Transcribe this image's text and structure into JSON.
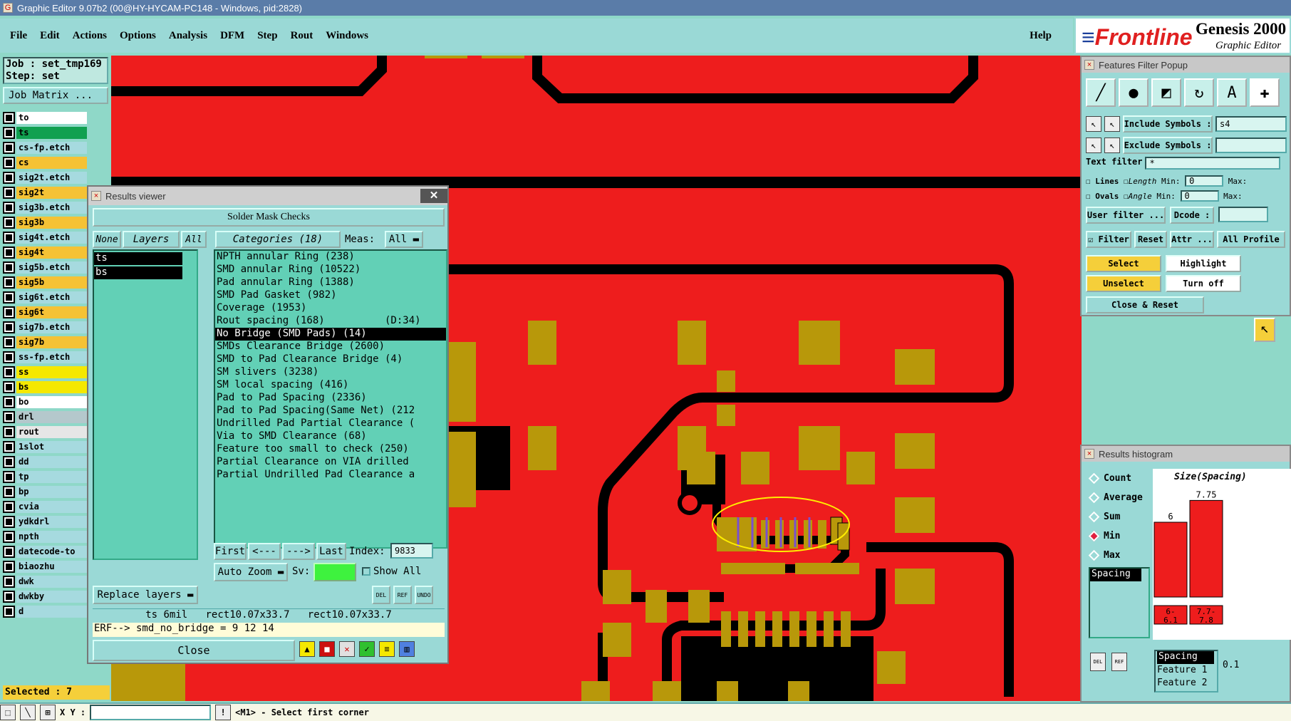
{
  "window": {
    "title": "Graphic Editor 9.07b2 (00@HY-HYCAM-PC148 - Windows, pid:2828)"
  },
  "menu": {
    "items": [
      "File",
      "Edit",
      "Actions",
      "Options",
      "Analysis",
      "DFM",
      "Step",
      "Rout",
      "Windows"
    ],
    "help": "Help"
  },
  "brand": {
    "logo": "Frontline",
    "product": "Genesis 2000",
    "subtitle": "Graphic Editor"
  },
  "job": {
    "line1": "Job : set_tmp169",
    "line2": "Step: set",
    "matrix_button": "Job Matrix ..."
  },
  "layers": [
    {
      "name": "to",
      "color": "#ffffff"
    },
    {
      "name": "ts",
      "color": "#10a050"
    },
    {
      "name": "cs-fp.etch",
      "color": "#a6dadf"
    },
    {
      "name": "cs",
      "color": "#f5c235"
    },
    {
      "name": "sig2t.etch",
      "color": "#a6dadf"
    },
    {
      "name": "sig2t",
      "color": "#f5c235"
    },
    {
      "name": "sig3b.etch",
      "color": "#a6dadf"
    },
    {
      "name": "sig3b",
      "color": "#f5c235"
    },
    {
      "name": "sig4t.etch",
      "color": "#a6dadf"
    },
    {
      "name": "sig4t",
      "color": "#f5c235"
    },
    {
      "name": "sig5b.etch",
      "color": "#a6dadf"
    },
    {
      "name": "sig5b",
      "color": "#f5c235"
    },
    {
      "name": "sig6t.etch",
      "color": "#a6dadf"
    },
    {
      "name": "sig6t",
      "color": "#f5c235"
    },
    {
      "name": "sig7b.etch",
      "color": "#a6dadf"
    },
    {
      "name": "sig7b",
      "color": "#f5c235"
    },
    {
      "name": "ss-fp.etch",
      "color": "#a6dadf"
    },
    {
      "name": "ss",
      "color": "#f5e800"
    },
    {
      "name": "bs",
      "color": "#f5e800"
    },
    {
      "name": "bo",
      "color": "#ffffff"
    },
    {
      "name": "drl",
      "color": "#b4c8cc"
    },
    {
      "name": "rout",
      "color": "#e6e6e6"
    },
    {
      "name": "1slot",
      "color": "#a6dadf"
    },
    {
      "name": "dd",
      "color": "#a6dadf"
    },
    {
      "name": "tp",
      "color": "#a6dadf"
    },
    {
      "name": "bp",
      "color": "#a6dadf"
    },
    {
      "name": "cvia",
      "color": "#a6dadf"
    },
    {
      "name": "ydkdrl",
      "color": "#a6dadf"
    },
    {
      "name": "npth",
      "color": "#a6dadf"
    },
    {
      "name": "datecode-to",
      "color": "#a6dadf"
    },
    {
      "name": "biaozhu",
      "color": "#a6dadf"
    },
    {
      "name": "dwk",
      "color": "#a6dadf"
    },
    {
      "name": "dwkby",
      "color": "#a6dadf"
    },
    {
      "name": "d",
      "color": "#a6dadf"
    }
  ],
  "selected": "Selected : 7",
  "results_viewer": {
    "title": "Results viewer",
    "header": "Solder Mask Checks",
    "none": "None",
    "layers_label": "Layers",
    "all": "All",
    "layer_list": [
      "ts",
      "bs"
    ],
    "categories_label": "Categories (18)",
    "meas_label": "Meas:",
    "meas_value": "All",
    "categories": [
      "NPTH annular Ring (238)",
      "SMD annular Ring (10522)",
      "Pad annular Ring (1388)",
      "SMD Pad Gasket (982)",
      "Coverage (1953)",
      "Rout spacing (168)          (D:34)",
      "No Bridge (SMD Pads) (14)",
      "SMDs Clearance Bridge (2600)",
      "SMD to Pad Clearance Bridge (4)",
      "SM slivers (3238)",
      "SM local spacing (416)",
      "Pad to Pad Spacing (2336)",
      "Pad to Pad Spacing(Same Net) (212",
      "Undrilled Pad Partial Clearance (",
      "Via to SMD Clearance (68)",
      "Feature too small to check (250)",
      "Partial Clearance on VIA drilled",
      "Partial Undrilled Pad Clearance a"
    ],
    "selected_category": "No Bridge (SMD Pads) (14)",
    "nav": {
      "first": "First",
      "prev": "<---",
      "next": "--->",
      "last": "Last",
      "index_label": "Index:",
      "index_value": "9833"
    },
    "auto_zoom": "Auto Zoom",
    "sv_label": "Sv:",
    "show_all": "Show All",
    "replace_layers": "Replace layers",
    "tool_labels": [
      "DEL",
      "REF",
      "UNDO"
    ],
    "info": "ts 6mil   rect10.07x33.7   rect10.07x33.7",
    "erf": "ERF--> smd_no_bridge = 9 12 14",
    "close": "Close"
  },
  "features_filter": {
    "title": "Features Filter Popup",
    "include_label": "Include Symbols :",
    "include_value": "s4",
    "exclude_label": "Exclude Symbols :",
    "exclude_value": "",
    "text_filter_label": "Text filter",
    "text_filter_value": "*",
    "lines": "Lines",
    "ovals": "Ovals",
    "length": "Length",
    "angle": "Angle",
    "min": "Min:",
    "max": "Max:",
    "min_value": "0",
    "user_filter": "User filter ...",
    "dcode": "Dcode :",
    "filter": "Filter",
    "reset": "Reset",
    "attr": "Attr ...",
    "all_profile": "All Profile",
    "select": "Select",
    "highlight": "Highlight",
    "unselect": "Unselect",
    "turn_off": "Turn off",
    "close_reset": "Close & Reset"
  },
  "histogram": {
    "title": "Results histogram",
    "modes": [
      "Count",
      "Average",
      "Sum",
      "Min",
      "Max"
    ],
    "active_mode": "Min",
    "meas_list": [
      "Spacing"
    ],
    "chart_title": "Size(Spacing)",
    "bars": [
      {
        "label": "6",
        "bin": "6-\n6.1",
        "value": 6
      },
      {
        "label": "7.75",
        "bin": "7.7-\n7.8",
        "value": 7.75
      }
    ],
    "legend": [
      "Spacing",
      "Feature 1",
      "Feature 2"
    ],
    "step": "0.1",
    "del": "DEL",
    "ref": "REF"
  },
  "status": {
    "xy_label": "X Y :",
    "message": "<M1> - Select first corner"
  },
  "colors": {
    "bg": "#8fd8c8",
    "canvas": "#ee1d1d",
    "pad": "#b8980a",
    "accent": "#f5cf3a"
  }
}
